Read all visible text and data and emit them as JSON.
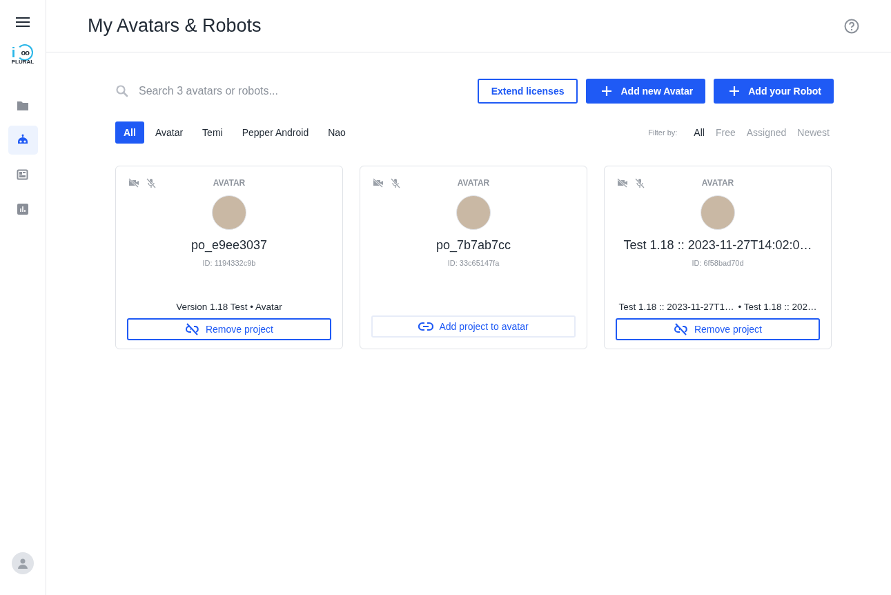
{
  "sidebar": {
    "logo": {
      "letter": "i",
      "inner": "oo",
      "word": "PLURAL"
    },
    "items": [
      {
        "kind": "folder",
        "selected": false
      },
      {
        "kind": "robot",
        "selected": true
      },
      {
        "kind": "panel",
        "selected": false
      },
      {
        "kind": "chart",
        "selected": false
      }
    ]
  },
  "header": {
    "title": "My Avatars & Robots"
  },
  "search": {
    "placeholder": "Search 3 avatars or robots..."
  },
  "buttons": [
    {
      "label": "Extend licenses",
      "kind": "outline"
    },
    {
      "label": "Add new Avatar",
      "kind": "add"
    },
    {
      "label": "Add your Robot",
      "kind": "add"
    }
  ],
  "tabs": [
    {
      "label": "All",
      "selected": true
    },
    {
      "label": "Avatar",
      "selected": false
    },
    {
      "label": "Temi",
      "selected": false
    },
    {
      "label": "Pepper Android",
      "selected": false
    },
    {
      "label": "Nao",
      "selected": false
    }
  ],
  "filter": {
    "label": "Filter by:",
    "options": [
      {
        "label": "All",
        "selected": true
      },
      {
        "label": "Free",
        "selected": false
      },
      {
        "label": "Assigned",
        "selected": false
      },
      {
        "label": "Newest",
        "selected": false
      }
    ]
  },
  "cards": [
    {
      "type": "AVATAR",
      "name": "po_e9ee3037",
      "id": "ID: 1194332c9b",
      "projects": [
        "Version 1.18 Test • Avatar"
      ],
      "action": {
        "kind": "remove",
        "label": "Remove project"
      }
    },
    {
      "type": "AVATAR",
      "name": "po_7b7ab7cc",
      "id": "ID: 33c65147fa",
      "action": {
        "kind": "add",
        "label": "Add project to avatar"
      }
    },
    {
      "type": "AVATAR",
      "name": "Test 1.18 :: 2023-11-27T14:02:0…",
      "id": "ID: 6f58bad70d",
      "projects": [
        "Test 1.18 :: 2023-11-27T1…",
        "• Test 1.18 :: 202…"
      ],
      "action": {
        "kind": "remove",
        "label": "Remove project"
      }
    }
  ]
}
